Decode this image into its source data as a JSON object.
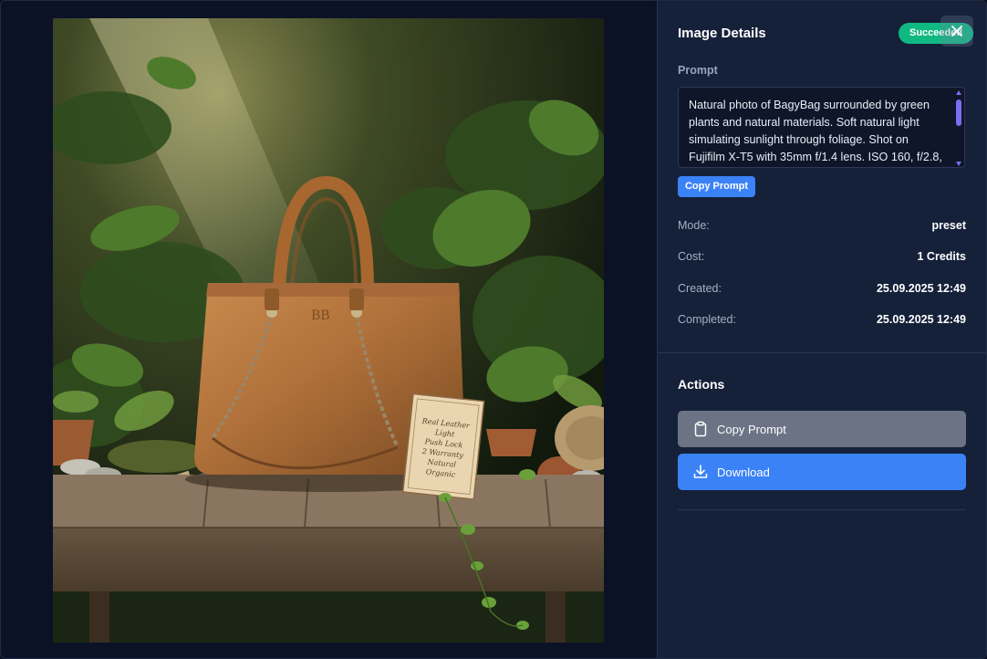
{
  "panel": {
    "title": "Image Details",
    "status": "Succeeded",
    "status_color": "#10b981",
    "prompt_label": "Prompt",
    "prompt_text": "Natural photo of BagyBag surrounded by green plants and natural materials. Soft natural light simulating sunlight through foliage. Shot on Fujifilm X-T5 with 35mm f/1.4 lens. ISO 160, f/2.8,",
    "copy_prompt_small": "Copy Prompt",
    "meta": [
      {
        "key": "Mode:",
        "value": "preset"
      },
      {
        "key": "Cost:",
        "value": "1 Credits"
      },
      {
        "key": "Created:",
        "value": "25.09.2025 12:49"
      },
      {
        "key": "Completed:",
        "value": "25.09.2025 12:49"
      }
    ],
    "actions_title": "Actions",
    "copy_prompt_button": "Copy Prompt",
    "download_button": "Download",
    "accent_color": "#3b82f6"
  },
  "photo": {
    "tag_lines": [
      "Real Leather",
      "Light",
      "Push Lock",
      "2 Warranty",
      "Natural",
      "Organic"
    ],
    "icon": "generated-product-photo"
  },
  "icons": {
    "close": "close-icon",
    "clipboard": "clipboard-icon",
    "download": "download-icon"
  }
}
